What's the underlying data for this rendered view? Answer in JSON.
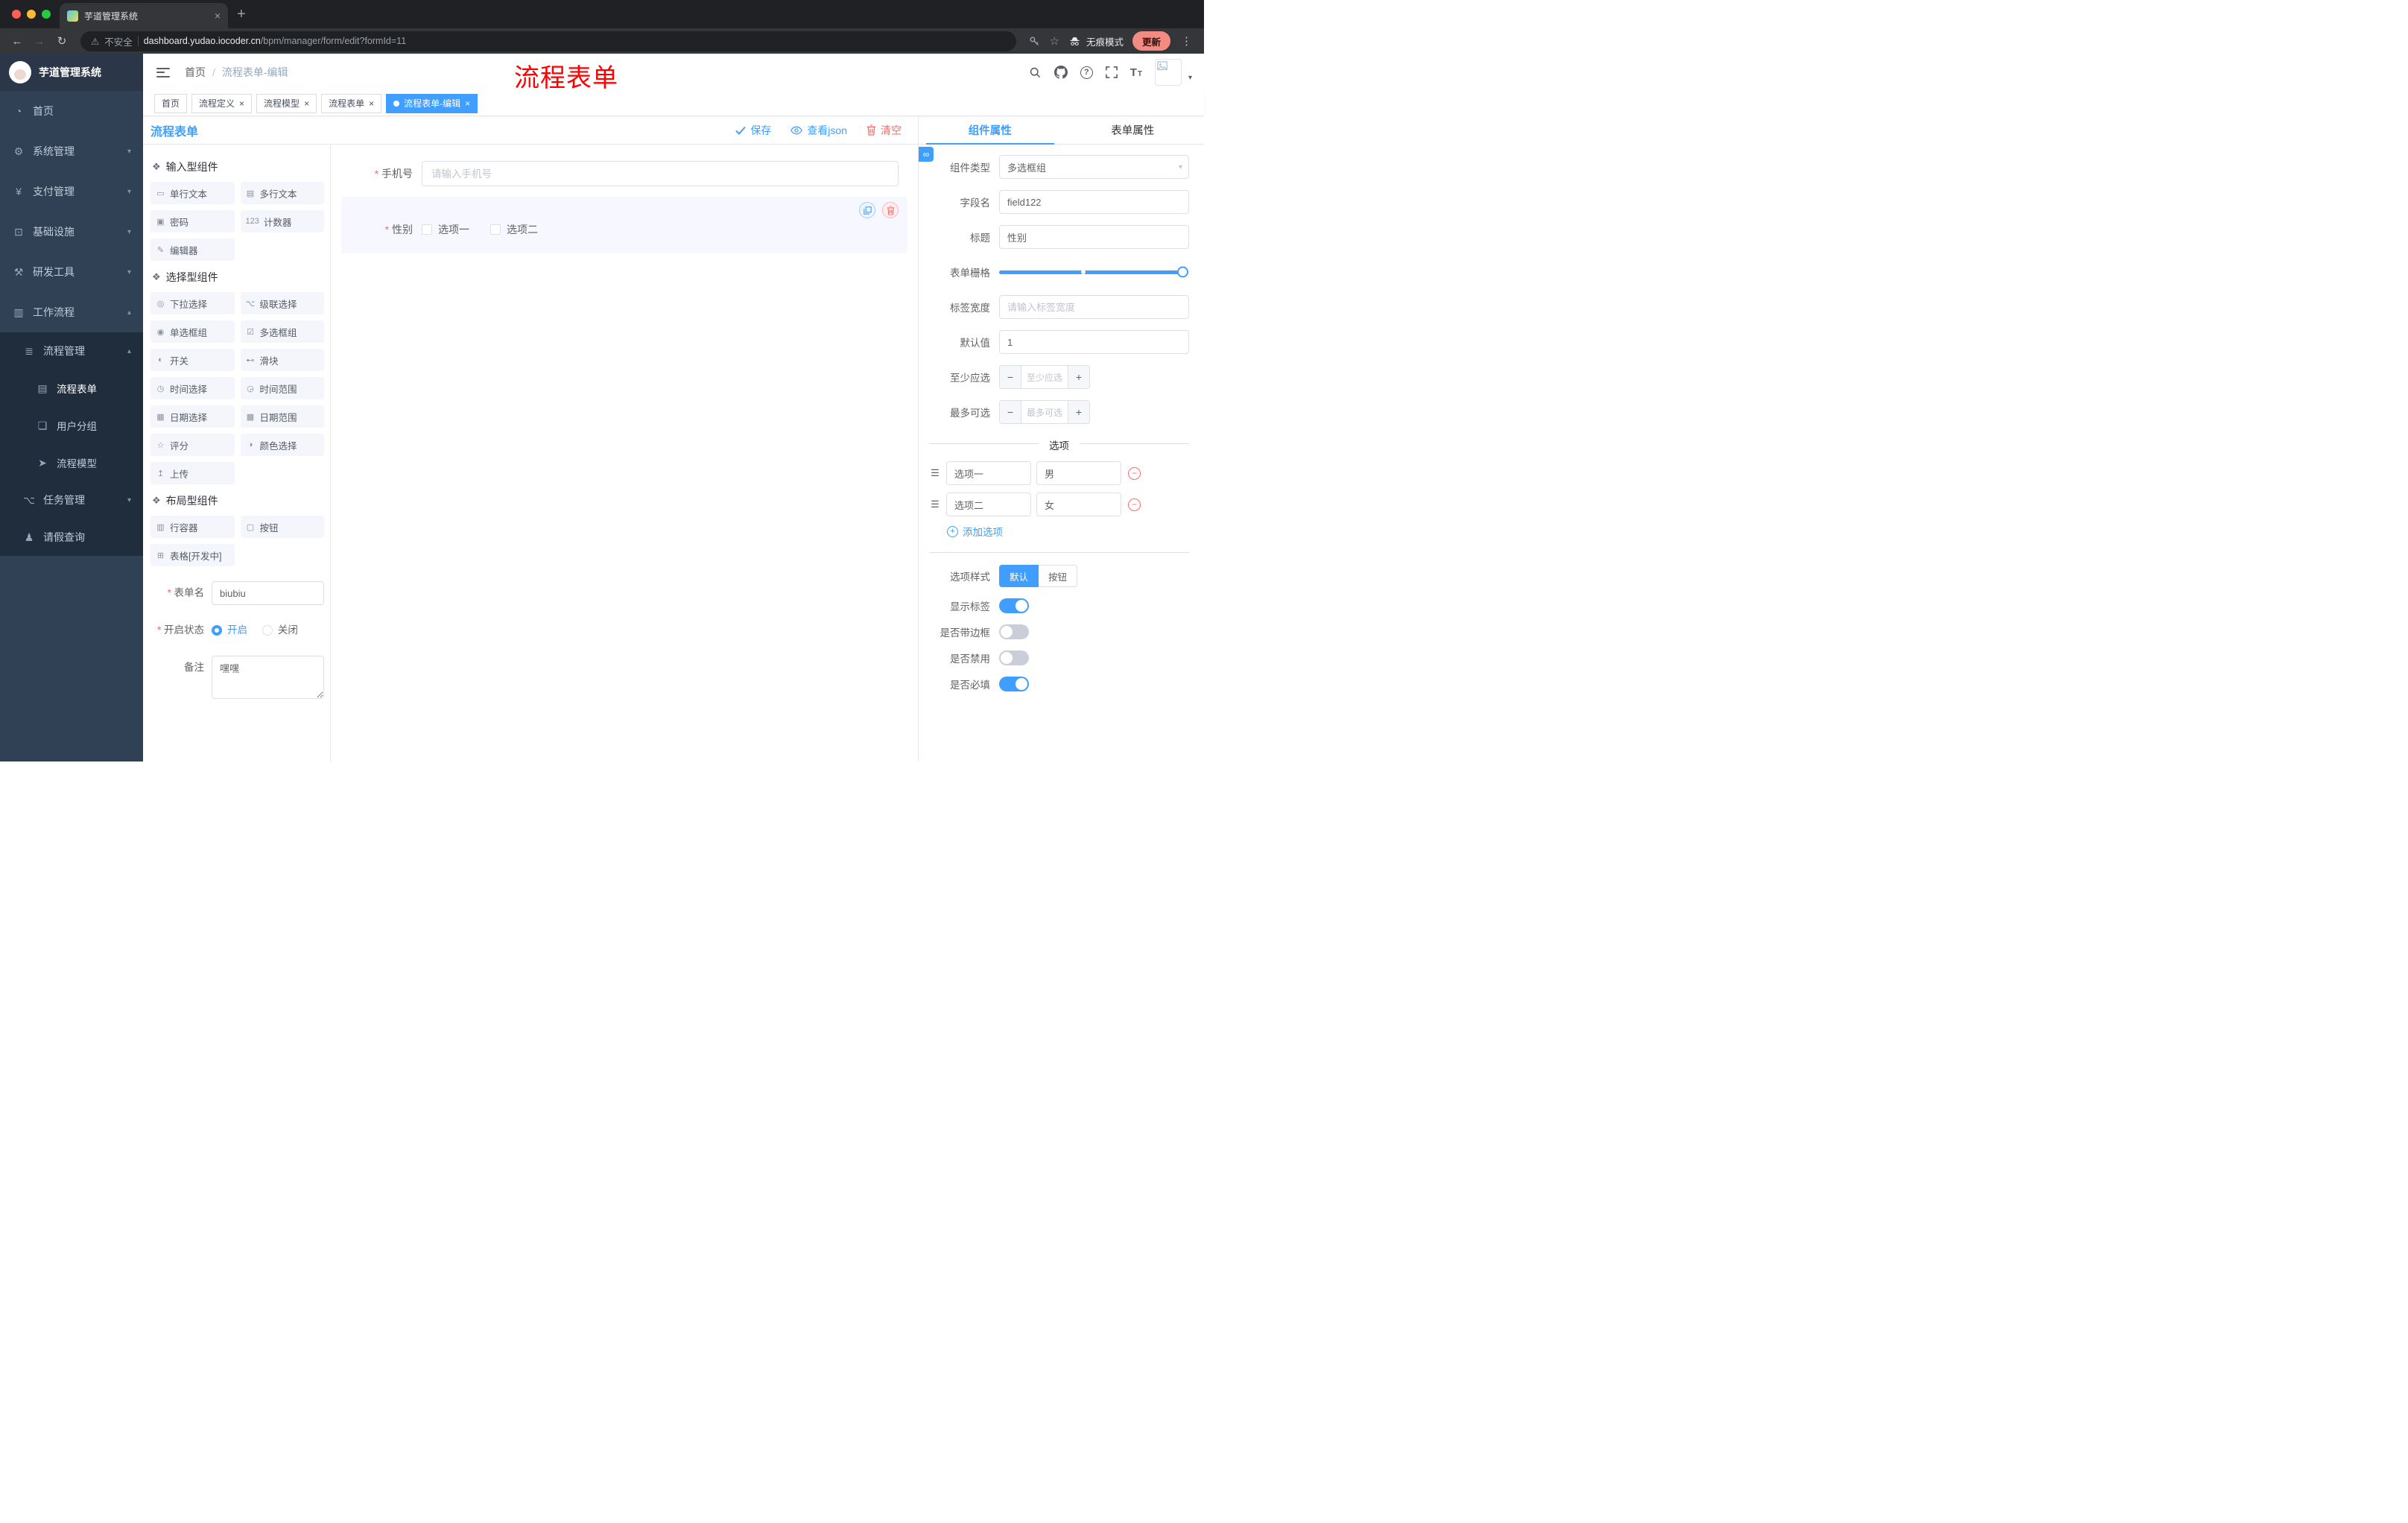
{
  "colors": {
    "accent": "#409eff",
    "danger": "#f56c6c",
    "annotation": "#ff0000",
    "sidebar_bg": "#304156",
    "submenu_bg": "#1f2d3d",
    "active_tag": "#409eff"
  },
  "icons": {
    "close": "×",
    "new_tab": "+",
    "back": "←",
    "forward": "→",
    "reload": "↻",
    "warning": "⚠",
    "star": "☆",
    "menu_dots": "⋮",
    "caret_down": "▾",
    "caret_up": "▴",
    "question": "?",
    "minus": "−",
    "plus": "+",
    "drag": "☰",
    "link": "∞",
    "home": "◔",
    "gear": "⚙",
    "yen": "¥",
    "infra": "⊡",
    "tools": "⚒",
    "workflow": "▥",
    "process": "≣",
    "doc": "▤",
    "chat": "❏",
    "plane": "➤",
    "branch": "⌥",
    "person": "♟",
    "section": "❖",
    "font_size_large": "T",
    "font_size_small": "T"
  },
  "browser": {
    "tab_title": "芋道管理系统",
    "security_label": "不安全",
    "url_host": "dashboard.yudao.iocoder.cn",
    "url_path": "/bpm/manager/form/edit?formId=11",
    "incognito_label": "无痕模式",
    "update_label": "更新"
  },
  "sidebar": {
    "logo_title": "芋道管理系统",
    "home": "首页",
    "system": "系统管理",
    "payment": "支付管理",
    "infrastructure": "基础设施",
    "devtools": "研发工具",
    "workflow": "工作流程",
    "process_mgmt": "流程管理",
    "process_form": "流程表单",
    "user_group": "用户分组",
    "process_model": "流程模型",
    "task_mgmt": "任务管理",
    "leave_query": "请假查询"
  },
  "header": {
    "breadcrumb_home": "首页",
    "breadcrumb_separator": "/",
    "breadcrumb_current": "流程表单-编辑",
    "annotation": "流程表单"
  },
  "tags": [
    {
      "label": "首页",
      "active": false,
      "closable": false
    },
    {
      "label": "流程定义",
      "active": false,
      "closable": true
    },
    {
      "label": "流程模型",
      "active": false,
      "closable": true
    },
    {
      "label": "流程表单",
      "active": false,
      "closable": true
    },
    {
      "label": "流程表单-编辑",
      "active": true,
      "closable": true
    }
  ],
  "designer": {
    "title": "流程表单",
    "actions": {
      "save": "保存",
      "view_json": "查看json",
      "clear": "清空"
    },
    "palette": {
      "sections": [
        {
          "title": "输入型组件",
          "items": [
            {
              "icon": "▭",
              "label": "单行文本"
            },
            {
              "icon": "▤",
              "label": "多行文本"
            },
            {
              "icon": "▣",
              "label": "密码"
            },
            {
              "icon": "123",
              "label": "计数器"
            },
            {
              "icon": "✎",
              "label": "编辑器"
            }
          ]
        },
        {
          "title": "选择型组件",
          "items": [
            {
              "icon": "◎",
              "label": "下拉选择"
            },
            {
              "icon": "⌥",
              "label": "级联选择"
            },
            {
              "icon": "◉",
              "label": "单选框组"
            },
            {
              "icon": "☑",
              "label": "多选框组"
            },
            {
              "icon": "◐",
              "label": "开关"
            },
            {
              "icon": "⊷",
              "label": "滑块"
            },
            {
              "icon": "◷",
              "label": "时间选择"
            },
            {
              "icon": "◶",
              "label": "时间范围"
            },
            {
              "icon": "▦",
              "label": "日期选择"
            },
            {
              "icon": "▩",
              "label": "日期范围"
            },
            {
              "icon": "☆",
              "label": "评分"
            },
            {
              "icon": "◑",
              "label": "颜色选择"
            },
            {
              "icon": "↥",
              "label": "上传"
            }
          ]
        },
        {
          "title": "布局型组件",
          "items": [
            {
              "icon": "▥",
              "label": "行容器"
            },
            {
              "icon": "▢",
              "label": "按钮"
            },
            {
              "icon": "⊞",
              "label": "表格[开发中]"
            }
          ]
        }
      ]
    },
    "form": {
      "name_label": "表单名",
      "name_value": "biubiu",
      "status_label": "开启状态",
      "status_on": "开启",
      "status_off": "关闭",
      "remark_label": "备注",
      "remark_value": "嘿嘿"
    },
    "canvas": {
      "phone": {
        "label": "手机号",
        "placeholder": "请输入手机号"
      },
      "gender": {
        "label": "性别",
        "option1": "选项一",
        "option2": "选项二"
      }
    }
  },
  "panel": {
    "tab_component": "组件属性",
    "tab_form": "表单属性",
    "component_type": {
      "label": "组件类型",
      "value": "多选框组"
    },
    "field_name": {
      "label": "字段名",
      "value": "field122"
    },
    "title": {
      "label": "标题",
      "value": "性别"
    },
    "grid": {
      "label": "表单栅格"
    },
    "label_width": {
      "label": "标签宽度",
      "placeholder": "请输入标签宽度"
    },
    "default_value": {
      "label": "默认值",
      "value": "1"
    },
    "min_select": {
      "label": "至少应选",
      "placeholder": "至少应选"
    },
    "max_select": {
      "label": "最多可选",
      "placeholder": "最多可选"
    },
    "options_title": "选项",
    "options": [
      {
        "label": "选项一",
        "value": "男"
      },
      {
        "label": "选项二",
        "value": "女"
      }
    ],
    "add_option": "添加选项",
    "option_style": {
      "label": "选项样式",
      "options": [
        "默认",
        "按钮"
      ],
      "selected": "默认"
    },
    "show_label": {
      "label": "显示标签",
      "on": true
    },
    "border": {
      "label": "是否带边框",
      "on": false
    },
    "disabled": {
      "label": "是否禁用",
      "on": false
    },
    "required": {
      "label": "是否必填",
      "on": true
    }
  }
}
